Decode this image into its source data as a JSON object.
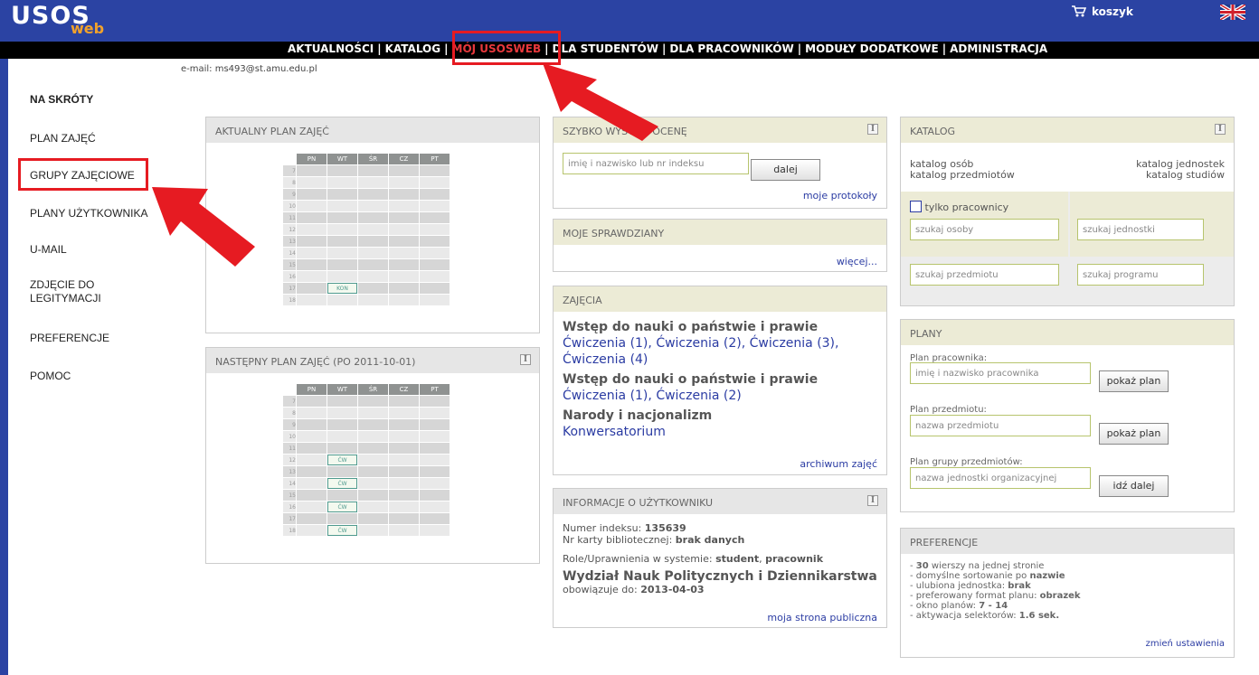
{
  "app": {
    "logo_main": "USOS",
    "logo_sub": "web",
    "cart": "koszyk"
  },
  "menu": [
    {
      "label": "AKTUALNOŚCI",
      "active": false
    },
    {
      "label": "KATALOG",
      "active": false
    },
    {
      "label": "MÓJ USOSWEB",
      "active": true
    },
    {
      "label": "DLA STUDENTÓW",
      "active": false
    },
    {
      "label": "DLA PRACOWNIKÓW",
      "active": false
    },
    {
      "label": "MODUŁY DODATKOWE",
      "active": false
    },
    {
      "label": "ADMINISTRACJA",
      "active": false
    }
  ],
  "user": {
    "email": "e-mail: ms493@st.amu.edu.pl"
  },
  "sidebar": {
    "items": [
      "NA SKRÓTY",
      "PLAN ZAJĘĆ",
      "GRUPY ZAJĘCIOWE",
      "PLANY UŻYTKOWNIKA",
      "U-MAIL",
      "ZDJĘCIE DO",
      "LEGITYMACJI",
      "PREFERENCJE",
      "POMOC"
    ]
  },
  "plan_current": {
    "title": "AKTUALNY PLAN ZAJĘĆ",
    "days": [
      "PN",
      "WT",
      "ŚR",
      "CZ",
      "PT"
    ],
    "hours": [
      "7",
      "8",
      "9",
      "10",
      "11",
      "12",
      "13",
      "14",
      "15",
      "16",
      "17",
      "18"
    ],
    "block": "KON"
  },
  "plan_next": {
    "title": "NASTĘPNY PLAN ZAJĘĆ (po 2011-10-01)",
    "days": [
      "PN",
      "WT",
      "ŚR",
      "CZ",
      "PT"
    ],
    "hours": [
      "7",
      "8",
      "9",
      "10",
      "11",
      "12",
      "13",
      "14",
      "15",
      "16",
      "17",
      "18"
    ],
    "block": "ĆW"
  },
  "grade": {
    "title": "SZYBKO WYSTAW OCENĘ",
    "placeholder": "imię i nazwisko lub nr indeksu",
    "button": "dalej",
    "link": "moje protokoły"
  },
  "tests": {
    "title": "MOJE SPRAWDZIANY",
    "link": "więcej..."
  },
  "classes": {
    "title": "ZAJĘCIA",
    "course1": "Wstęp do nauki o państwie i prawie",
    "course1_groups": [
      "Ćwiczenia (1)",
      "Ćwiczenia (2)",
      "Ćwiczenia (3)",
      "Ćwiczenia (4)"
    ],
    "course2": "Wstęp do nauki o państwie i prawie",
    "course2_groups": [
      "Ćwiczenia (1)",
      "Ćwiczenia (2)"
    ],
    "course3": "Narody i nacjonalizm",
    "course3_group": "Konwersatorium",
    "link": "archiwum zajęć",
    "comma": ","
  },
  "userinfo": {
    "title": "INFORMACJE O UŻYTKOWNIKU",
    "index_label": "Numer indeksu: ",
    "index_value": "135639",
    "card_label": "Nr karty bibliotecznej: ",
    "card_value": "brak danych",
    "roles_label": "Role/Uprawnienia w systemie: ",
    "roles_value1": "student",
    "roles_sep": ", ",
    "roles_value2": "pracownik",
    "faculty": "Wydział Nauk Politycznych i Dziennikarstwa",
    "valid_label": "obowiązuje do: ",
    "valid_value": "2013-04-03",
    "link": "moja strona publiczna"
  },
  "catalog": {
    "title": "KATALOG",
    "link_persons": "katalog osób",
    "link_courses": "katalog przedmiotów",
    "link_units": "katalog jednostek",
    "link_studies": "katalog studiów",
    "checkbox": "tylko pracownicy",
    "ph_person": "szukaj osoby",
    "ph_unit": "szukaj jednostki",
    "ph_course": "szukaj przedmiotu",
    "ph_program": "szukaj programu"
  },
  "plans": {
    "title": "PLANY",
    "emp_label": "Plan pracownika:",
    "emp_ph": "imię i nazwisko pracownika",
    "emp_btn": "pokaż plan",
    "course_label": "Plan przedmiotu:",
    "course_ph": "nazwa przedmiotu",
    "course_btn": "pokaż plan",
    "group_label": "Plan grupy przedmiotów:",
    "group_ph": "nazwa jednostki organizacyjnej",
    "group_btn": "idź dalej"
  },
  "prefs": {
    "title": "PREFERENCJE",
    "l1_a": "- ",
    "l1_b": "30",
    "l1_c": " wierszy na jednej stronie",
    "l2_a": "- domyślne sortowanie po ",
    "l2_b": "nazwie",
    "l3_a": "- ulubiona jednostka: ",
    "l3_b": "brak",
    "l4_a": "- preferowany format planu: ",
    "l4_b": "obrazek",
    "l5_a": "- okno planów: ",
    "l5_b": "7 - 14",
    "l6_a": "- aktywacja selektorów: ",
    "l6_b": "1.6 sek.",
    "link": "zmień ustawienia"
  },
  "colors": {
    "brand": "#2b43a3",
    "active_menu": "#e8383c",
    "accent_logo": "#f2a22b",
    "link": "#2b3ca3",
    "highlight": "#e61b22"
  }
}
